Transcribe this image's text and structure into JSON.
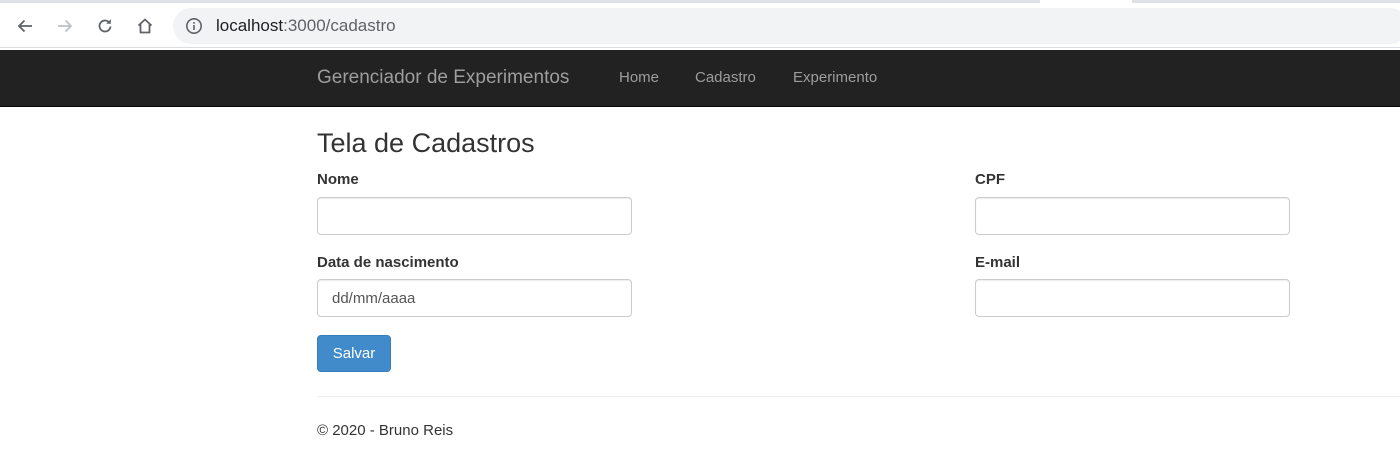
{
  "browser": {
    "url_host": "localhost",
    "url_rest": ":3000/cadastro"
  },
  "navbar": {
    "brand": "Gerenciador de Experimentos",
    "links": [
      {
        "label": "Home"
      },
      {
        "label": "Cadastro"
      },
      {
        "label": "Experimento"
      }
    ]
  },
  "form": {
    "title": "Tela de Cadastros",
    "nome_label": "Nome",
    "nome_value": "",
    "cpf_label": "CPF",
    "cpf_value": "",
    "nascimento_label": "Data de nascimento",
    "nascimento_placeholder": "dd/mm/aaaa",
    "email_label": "E-mail",
    "email_value": "",
    "submit_label": "Salvar"
  },
  "footer": {
    "text": "© 2020 - Bruno Reis"
  },
  "colors": {
    "navbar_bg": "#222222",
    "navbar_text": "#9d9d9d",
    "primary_button": "#428bca"
  }
}
